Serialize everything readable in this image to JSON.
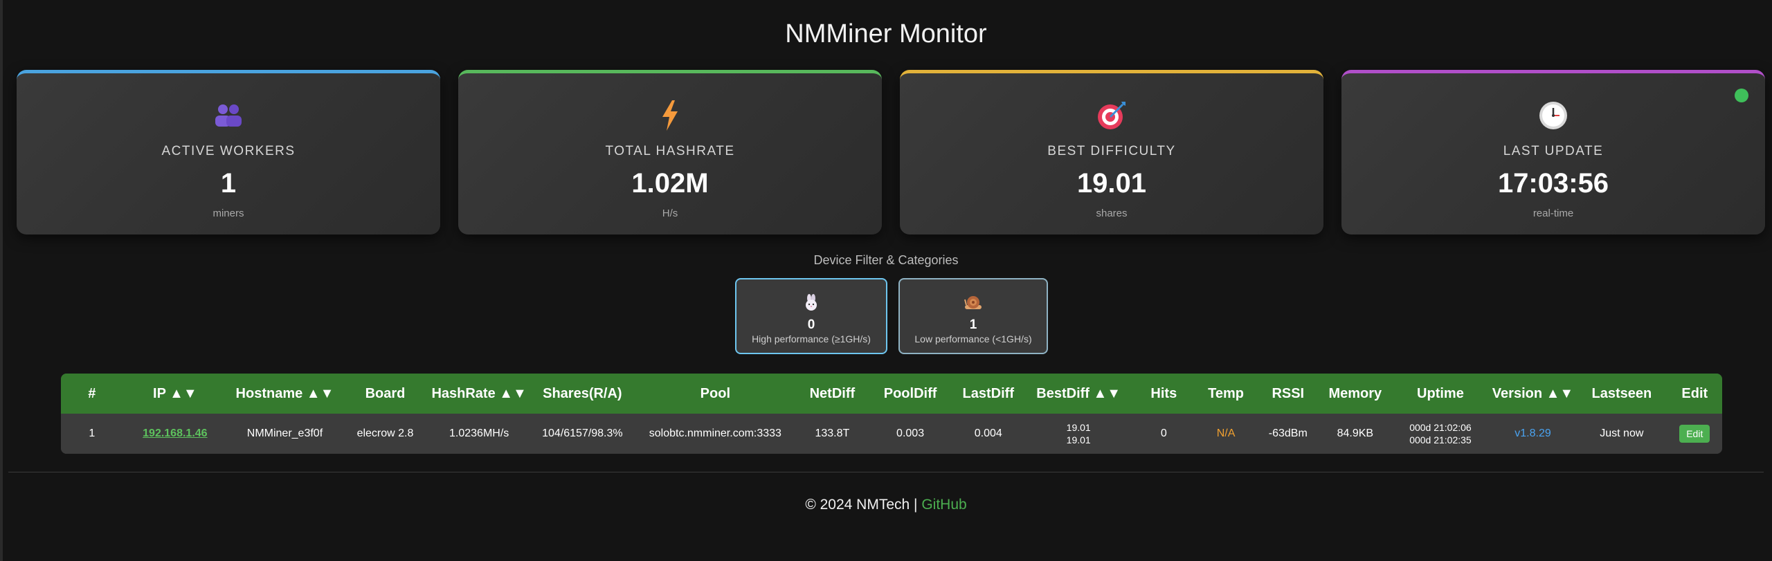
{
  "header": {
    "title": "NMMiner Monitor"
  },
  "cards": [
    {
      "label": "ACTIVE WORKERS",
      "value": "1",
      "unit": "miners",
      "accent": "#4aa3df",
      "icon": "users-icon"
    },
    {
      "label": "TOTAL HASHRATE",
      "value": "1.02M",
      "unit": "H/s",
      "accent": "#58b85c",
      "icon": "lightning-icon"
    },
    {
      "label": "BEST DIFFICULTY",
      "value": "19.01",
      "unit": "shares",
      "accent": "#e2b23a",
      "icon": "target-icon"
    },
    {
      "label": "LAST UPDATE",
      "value": "17:03:56",
      "unit": "real-time",
      "accent": "#b04fc9",
      "icon": "clock-icon"
    }
  ],
  "status": {
    "color": "#3fbf5a"
  },
  "filter": {
    "title": "Device Filter & Categories",
    "categories": [
      {
        "count": "0",
        "label": "High performance (≥1GH/s)",
        "icon": "rabbit-icon"
      },
      {
        "count": "1",
        "label": "Low performance (<1GH/s)",
        "icon": "snail-icon"
      }
    ]
  },
  "table": {
    "headers": [
      "#",
      "IP ▲▼",
      "Hostname ▲▼",
      "Board",
      "HashRate ▲▼",
      "Shares(R/A)",
      "Pool",
      "NetDiff",
      "PoolDiff",
      "LastDiff",
      "BestDiff ▲▼",
      "Hits",
      "Temp",
      "RSSI",
      "Memory",
      "Uptime",
      "Version ▲▼",
      "Lastseen",
      "Edit"
    ],
    "rows": [
      {
        "num": "1",
        "ip": "192.168.1.46",
        "hostname": "NMMiner_e3f0f",
        "board": "elecrow 2.8",
        "hashrate": "1.0236MH/s",
        "shares": "104/6157/98.3%",
        "pool": "solobtc.nmminer.com:3333",
        "netdiff": "133.8T",
        "pooldiff": "0.003",
        "lastdiff": "0.004",
        "bestdiff_1": "19.01",
        "bestdiff_2": "19.01",
        "hits": "0",
        "temp": "N/A",
        "rssi": "-63dBm",
        "memory": "84.9KB",
        "uptime_1": "000d 21:02:06",
        "uptime_2": "000d 21:02:35",
        "version": "v1.8.29",
        "lastseen": "Just now",
        "edit": "Edit"
      }
    ]
  },
  "footer": {
    "copyright": "© 2024 NMTech | ",
    "link": "GitHub"
  }
}
